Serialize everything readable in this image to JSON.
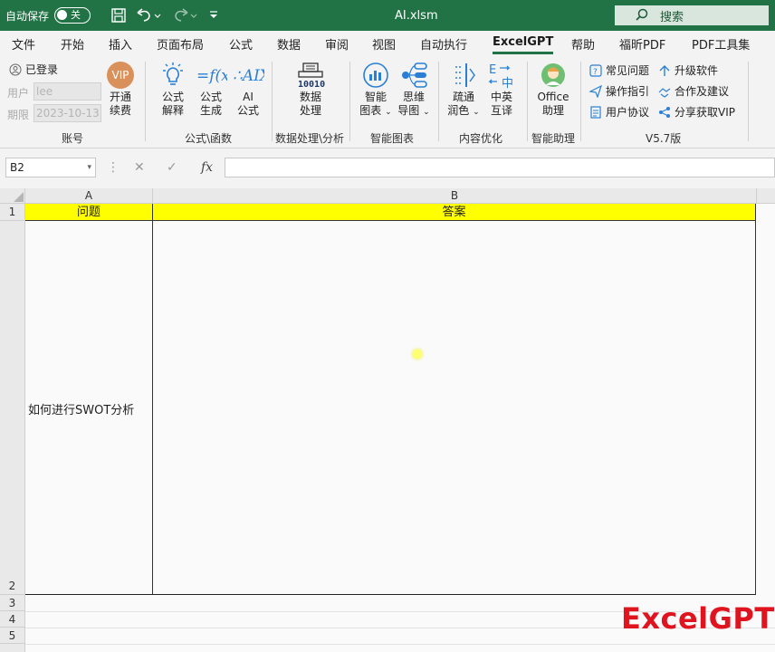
{
  "titlebar": {
    "autosave_label": "自动保存",
    "autosave_state": "关",
    "filename": "AI.xlsm",
    "search_label": "搜索"
  },
  "menu": {
    "tabs": [
      "文件",
      "开始",
      "插入",
      "页面布局",
      "公式",
      "数据",
      "审阅",
      "视图",
      "自动执行",
      "ExcelGPT",
      "帮助",
      "福昕PDF",
      "PDF工具集"
    ],
    "active_tab": "ExcelGPT"
  },
  "ribbon": {
    "account": {
      "logged_in": "已登录",
      "user_label": "用户",
      "user_value": "lee",
      "date_label": "期限",
      "date_value": "2023-10-13",
      "vip_badge": "VIP",
      "renew_label_1": "开通",
      "renew_label_2": "续费",
      "group_label": "账号"
    },
    "formula": {
      "explain_1": "公式",
      "explain_2": "解释",
      "generate_1": "公式",
      "generate_2": "生成",
      "ai_1": "AI",
      "ai_2": "公式",
      "group_label": "公式\\函数"
    },
    "data_processing": {
      "icon_text": "10010",
      "btn_1": "数据",
      "btn_2": "处理",
      "group_label": "数据处理\\分析"
    },
    "smart_chart": {
      "chart_1": "智能",
      "chart_2": "图表",
      "mind_1": "思维",
      "mind_2": "导图",
      "group_label": "智能图表"
    },
    "content": {
      "polish_1": "疏通",
      "polish_2": "润色",
      "trans_icon_top": "E",
      "trans_icon_bottom": "中",
      "trans_1": "中英",
      "trans_2": "互译",
      "group_label": "内容优化"
    },
    "assistant": {
      "btn_1": "Office",
      "btn_2": "助理",
      "group_label": "智能助理"
    },
    "help": {
      "faq": "常见问题",
      "guide": "操作指引",
      "agreement": "用户协议",
      "upgrade": "升级软件",
      "cooperate": "合作及建议",
      "share": "分享获取VIP",
      "version": "V5.7版"
    }
  },
  "formula_bar": {
    "name_box": "B2",
    "fx": "fx",
    "formula": ""
  },
  "sheet": {
    "columns": [
      "A",
      "B"
    ],
    "rows": [
      "1",
      "2",
      "3",
      "4",
      "5"
    ],
    "header_a": "问题",
    "header_b": "答案",
    "cell_a2": "如何进行SWOT分析",
    "cell_b2": ""
  },
  "watermark": "ExcelGPT",
  "colors": {
    "excel_green": "#217346",
    "header_yellow": "#ffff00",
    "watermark_red": "#e0141e"
  }
}
